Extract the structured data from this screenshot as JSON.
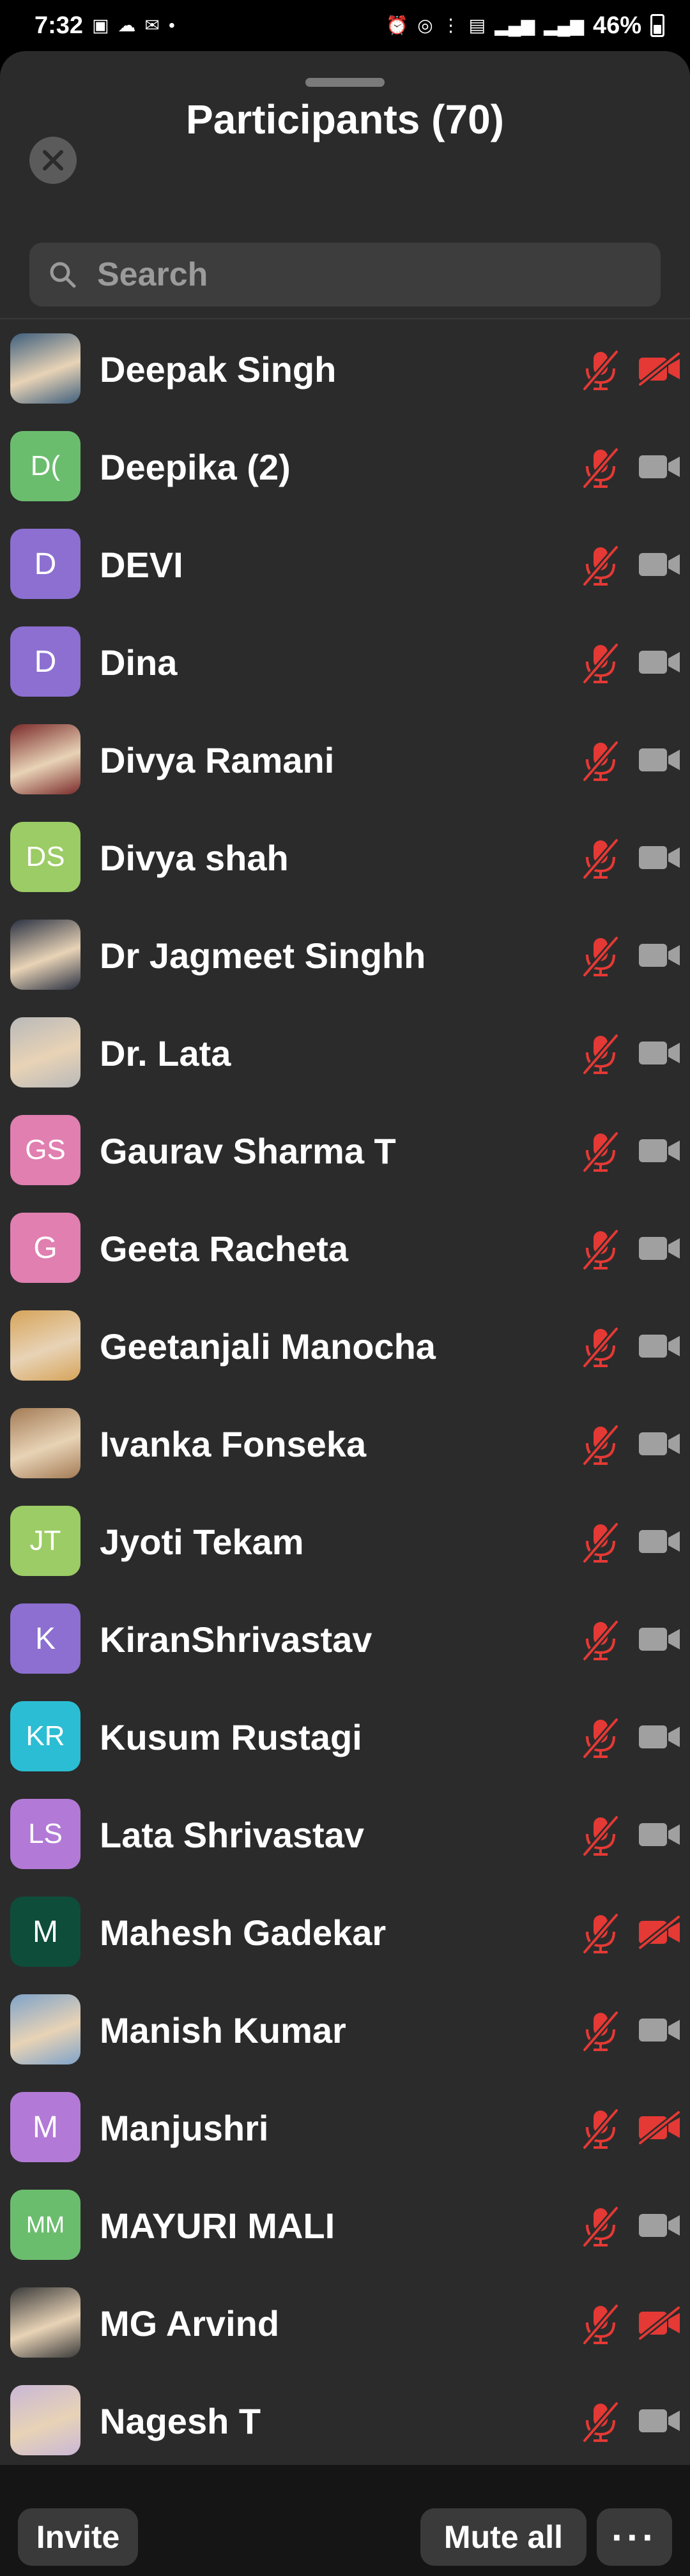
{
  "status_bar": {
    "time": "7:32",
    "battery": "46%",
    "left_icons": [
      "gallery-icon",
      "cloud-icon",
      "gmail-icon",
      "dot-icon"
    ],
    "right_icons": [
      "alarm-icon",
      "hotspot-icon",
      "volte-icon",
      "5g-icon",
      "signal-icon",
      "signal-r-icon"
    ]
  },
  "header": {
    "title": "Participants (70)"
  },
  "search": {
    "placeholder": "Search"
  },
  "participants": [
    {
      "name": "Deepak Singh",
      "initials": "",
      "avatar_color": "#3f5f7d",
      "photo": true,
      "mic_muted": true,
      "video_off": true
    },
    {
      "name": "Deepika (2)",
      "initials": "D(",
      "avatar_color": "#6bbd6e",
      "photo": false,
      "mic_muted": true,
      "video_off": false
    },
    {
      "name": "DEVI",
      "initials": "D",
      "avatar_color": "#8c6fd1",
      "photo": false,
      "mic_muted": true,
      "video_off": false
    },
    {
      "name": "Dina",
      "initials": "D",
      "avatar_color": "#8c6fd1",
      "photo": false,
      "mic_muted": true,
      "video_off": false
    },
    {
      "name": "Divya Ramani",
      "initials": "",
      "avatar_color": "#7a2a2a",
      "photo": true,
      "mic_muted": true,
      "video_off": false
    },
    {
      "name": "Divya shah",
      "initials": "DS",
      "avatar_color": "#9ccc65",
      "photo": false,
      "mic_muted": true,
      "video_off": false
    },
    {
      "name": "Dr Jagmeet Singhh",
      "initials": "",
      "avatar_color": "#2a3142",
      "photo": true,
      "mic_muted": true,
      "video_off": false
    },
    {
      "name": "Dr. Lata",
      "initials": "",
      "avatar_color": "#b9b9b9",
      "photo": true,
      "mic_muted": true,
      "video_off": false
    },
    {
      "name": "Gaurav Sharma T",
      "initials": "GS",
      "avatar_color": "#e07fb0",
      "photo": false,
      "mic_muted": true,
      "video_off": false
    },
    {
      "name": "Geeta  Racheta",
      "initials": "G",
      "avatar_color": "#e07fb0",
      "photo": false,
      "mic_muted": true,
      "video_off": false
    },
    {
      "name": "Geetanjali Manocha",
      "initials": "",
      "avatar_color": "#d6a45a",
      "photo": true,
      "mic_muted": true,
      "video_off": false
    },
    {
      "name": "Ivanka Fonseka",
      "initials": "",
      "avatar_color": "#a37b55",
      "photo": true,
      "mic_muted": true,
      "video_off": false
    },
    {
      "name": "Jyoti Tekam",
      "initials": "JT",
      "avatar_color": "#9ccc65",
      "photo": false,
      "mic_muted": true,
      "video_off": false
    },
    {
      "name": "KiranShrivastav",
      "initials": "K",
      "avatar_color": "#8c6fd1",
      "photo": false,
      "mic_muted": true,
      "video_off": false
    },
    {
      "name": "Kusum Rustagi",
      "initials": "KR",
      "avatar_color": "#2bbdd3",
      "photo": false,
      "mic_muted": true,
      "video_off": false
    },
    {
      "name": "Lata Shrivastav",
      "initials": "LS",
      "avatar_color": "#b27ad6",
      "photo": false,
      "mic_muted": true,
      "video_off": false
    },
    {
      "name": "Mahesh Gadekar",
      "initials": "M",
      "avatar_color": "#0d4d3a",
      "photo": false,
      "mic_muted": true,
      "video_off": true
    },
    {
      "name": "Manish Kumar",
      "initials": "",
      "avatar_color": "#7fa3c9",
      "photo": true,
      "mic_muted": true,
      "video_off": false
    },
    {
      "name": "Manjushri",
      "initials": "M",
      "avatar_color": "#b27ad6",
      "photo": false,
      "mic_muted": true,
      "video_off": true
    },
    {
      "name": "MAYURI MALI",
      "initials": "MM",
      "avatar_color": "#6bbd6e",
      "photo": false,
      "mic_muted": true,
      "video_off": false
    },
    {
      "name": "MG Arvind",
      "initials": "",
      "avatar_color": "#3a3a3a",
      "photo": true,
      "mic_muted": true,
      "video_off": true
    },
    {
      "name": "Nagesh T",
      "initials": "",
      "avatar_color": "#c9b7d6",
      "photo": true,
      "mic_muted": true,
      "video_off": false
    }
  ],
  "footer": {
    "invite_label": "Invite",
    "mute_all_label": "Mute all",
    "more_label": "···"
  },
  "colors": {
    "muted_red": "#e53935",
    "video_on_gray": "#a0a0a0",
    "sheet_background": "#2b2b2b"
  }
}
